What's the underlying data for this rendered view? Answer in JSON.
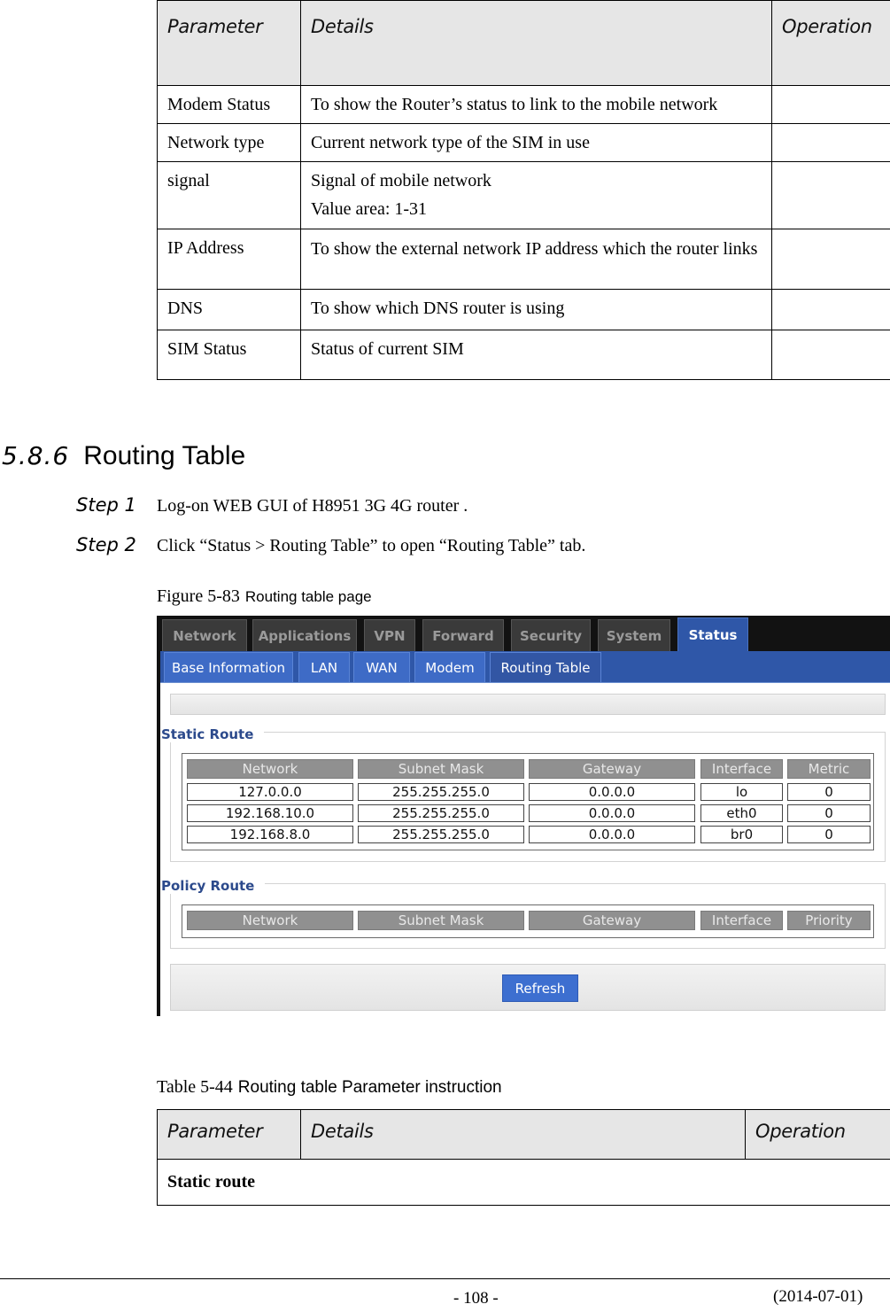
{
  "table_1": {
    "headers": [
      "Parameter",
      "Details",
      "Operation"
    ],
    "rows": [
      {
        "parameter": "Modem Status",
        "details": [
          "To show the Router’s status to link to the mobile network"
        ],
        "operation": ""
      },
      {
        "parameter": "Network type",
        "details": [
          "Current network type of the SIM in use"
        ],
        "operation": ""
      },
      {
        "parameter": "signal",
        "details": [
          "Signal of mobile network",
          "Value area: 1-31"
        ],
        "operation": ""
      },
      {
        "parameter": "IP Address",
        "details": [
          "To show the external network IP address which the router links"
        ],
        "operation": ""
      },
      {
        "parameter": "DNS",
        "details": [
          "To show which DNS router is using"
        ],
        "operation": ""
      },
      {
        "parameter": "SIM Status",
        "details": [
          "Status of current SIM"
        ],
        "operation": ""
      }
    ]
  },
  "section": {
    "number": "5.8.6",
    "title": "Routing Table"
  },
  "steps": [
    {
      "label": "Step 1",
      "text": "Log-on WEB GUI of H8951 3G 4G router ."
    },
    {
      "label": "Step 2",
      "text": "Click “Status > Routing Table” to open “Routing Table” tab."
    }
  ],
  "figure": {
    "number": "Figure 5-83",
    "title": "Routing table page"
  },
  "router_ui": {
    "main_tabs": [
      "Network",
      "Applications",
      "VPN",
      "Forward",
      "Security",
      "System",
      "Status"
    ],
    "active_main_tab": "Status",
    "sub_tabs": [
      "Base Information",
      "LAN",
      "WAN",
      "Modem",
      "Routing Table"
    ],
    "active_sub_tab": "Routing Table",
    "static_route": {
      "legend": "Static Route",
      "headers": [
        "Network",
        "Subnet Mask",
        "Gateway",
        "Interface",
        "Metric"
      ],
      "rows": [
        [
          "127.0.0.0",
          "255.255.255.0",
          "0.0.0.0",
          "lo",
          "0"
        ],
        [
          "192.168.10.0",
          "255.255.255.0",
          "0.0.0.0",
          "eth0",
          "0"
        ],
        [
          "192.168.8.0",
          "255.255.255.0",
          "0.0.0.0",
          "br0",
          "0"
        ]
      ]
    },
    "policy_route": {
      "legend": "Policy Route",
      "headers": [
        "Network",
        "Subnet Mask",
        "Gateway",
        "Interface",
        "Priority"
      ],
      "rows": []
    },
    "refresh_label": "Refresh",
    "colors": {
      "accent_blue": "#2f57a8",
      "button_blue": "#3d6fd0",
      "legend_text": "#2c4a8c",
      "header_gray": "#909090"
    }
  },
  "table_2": {
    "caption_number": "Table 5-44",
    "caption_title": "Routing table Parameter instruction",
    "headers": [
      "Parameter",
      "Details",
      "Operation"
    ],
    "rows": [
      {
        "section_label": "Static route"
      }
    ]
  },
  "footer": {
    "page_number": "- 108 -",
    "date": "(2014-07-01)"
  }
}
